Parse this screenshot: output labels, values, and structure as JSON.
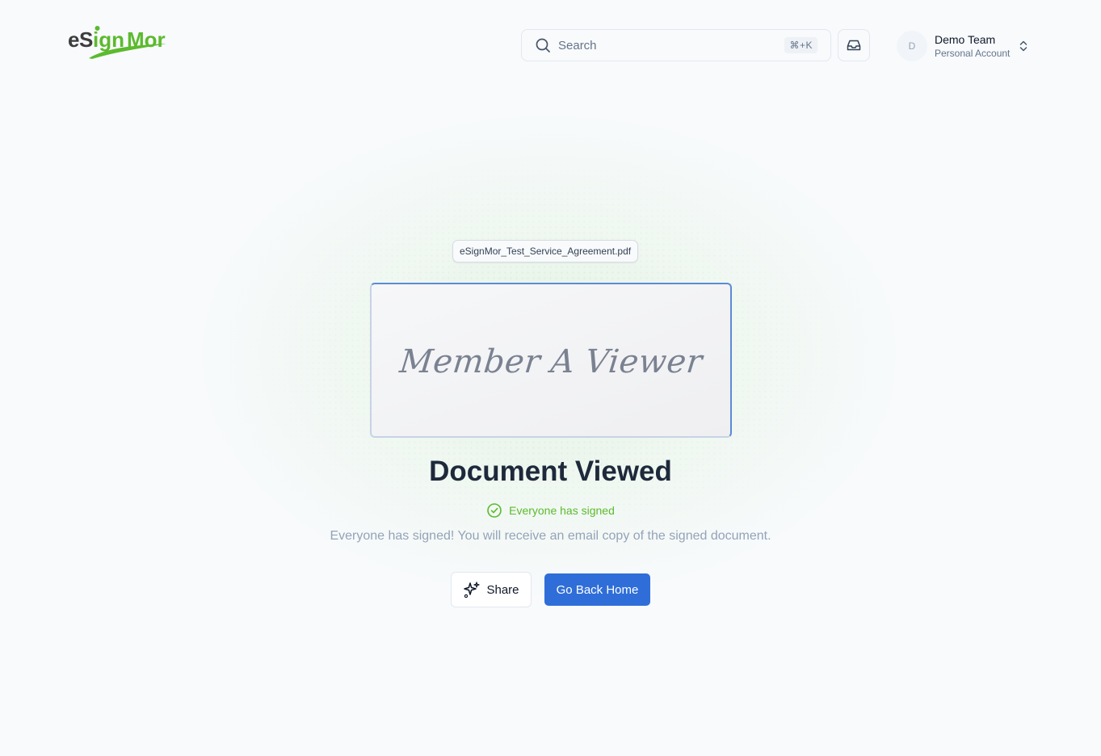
{
  "header": {
    "logo_text": "eSignMor",
    "search": {
      "placeholder": "Search",
      "shortcut": "⌘+K"
    },
    "account": {
      "avatar_initial": "D",
      "name": "Demo Team",
      "type": "Personal Account"
    }
  },
  "document": {
    "filename": "eSignMor_Test_Service_Agreement.pdf",
    "signature_text": "Member A Viewer"
  },
  "main": {
    "title": "Document Viewed",
    "status": "Everyone has signed",
    "message": "Everyone has signed! You will receive an email copy of the signed document.",
    "share_label": "Share",
    "home_label": "Go Back Home"
  },
  "colors": {
    "brand_green": "#5cba2e",
    "primary_blue": "#2f6ed8"
  }
}
